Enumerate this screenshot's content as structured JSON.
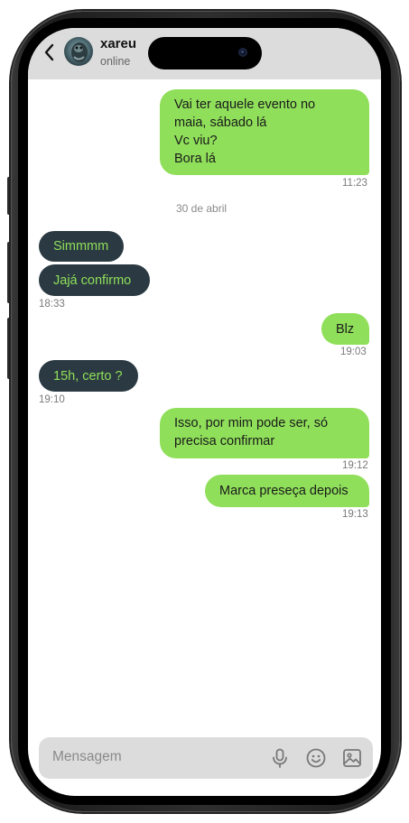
{
  "contact": {
    "name": "xareu",
    "status": "online"
  },
  "messages": [
    {
      "direction": "sent",
      "lines": [
        "Vai ter aquele evento no",
        "maia, sábado lá",
        "Vc viu?",
        "Bora lá"
      ],
      "time": "11:23"
    },
    {
      "separator": "30 de abril"
    },
    {
      "direction": "received",
      "text": "Simmmm"
    },
    {
      "direction": "received",
      "text": "Jajá confirmo",
      "time": "18:33"
    },
    {
      "direction": "sent",
      "text": "Blz",
      "time": "19:03"
    },
    {
      "direction": "received",
      "text": "15h, certo ?",
      "time": "19:10"
    },
    {
      "direction": "sent",
      "lines": [
        "Isso, por mim pode ser, só",
        "precisa confirmar"
      ],
      "time": "19:12"
    },
    {
      "direction": "sent",
      "text": "Marca preseça depois",
      "time": "19:13"
    }
  ],
  "input": {
    "placeholder": "Mensagem",
    "icons": [
      "microphone-icon",
      "emoji-icon",
      "image-icon"
    ]
  },
  "colors": {
    "sent_bubble": "#8fdf5a",
    "received_bubble": "#2b3a42",
    "received_text": "#8fdf5a",
    "header_bg": "#dcdcdc"
  }
}
